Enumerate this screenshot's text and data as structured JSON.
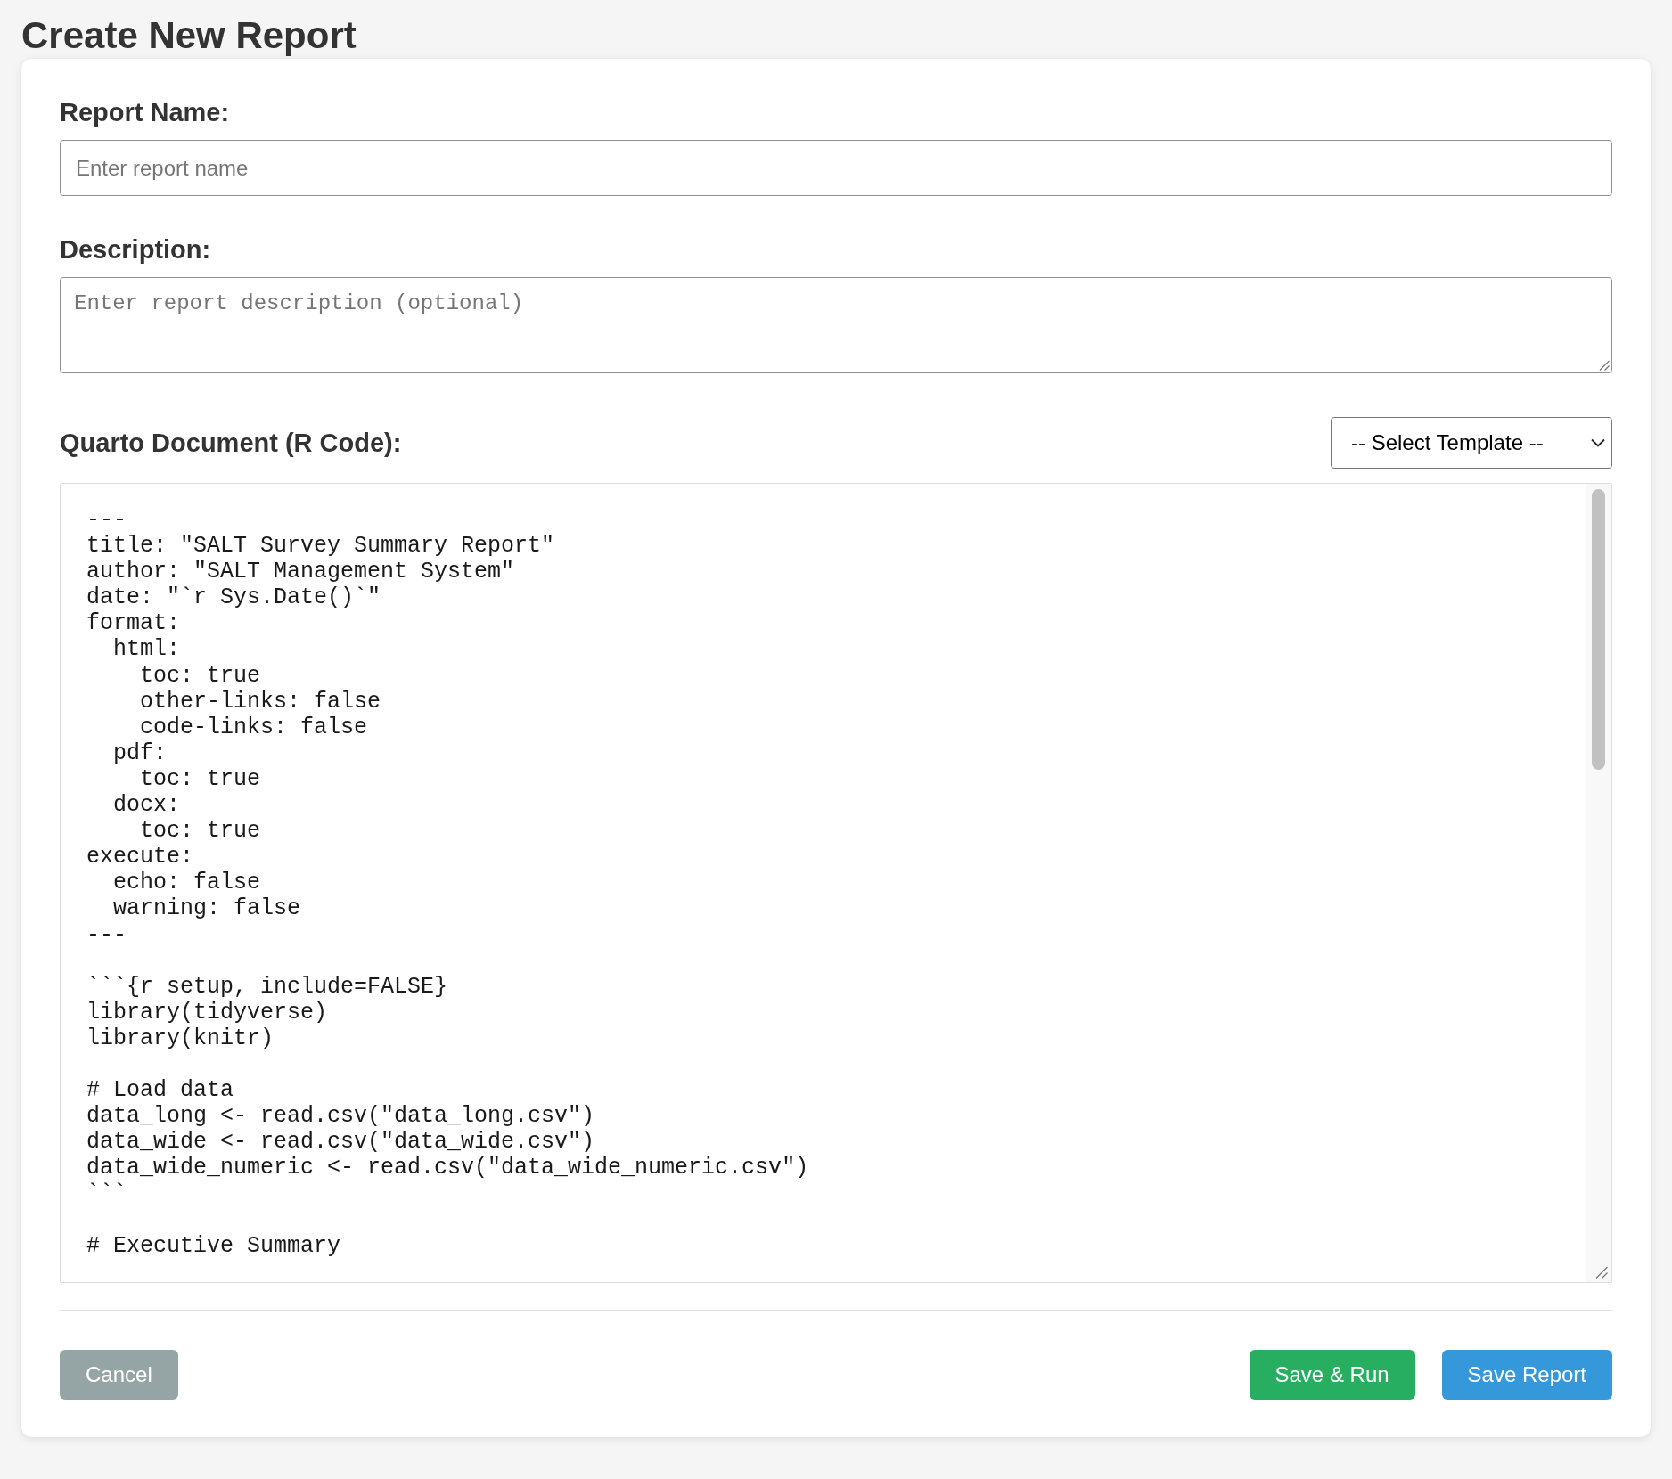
{
  "page": {
    "title": "Create New Report"
  },
  "form": {
    "fields": [
      {
        "kind": "text",
        "label": "Report Name:",
        "placeholder": "Enter report name"
      },
      {
        "kind": "textarea",
        "label": "Description:",
        "placeholder": "Enter report description (optional)"
      }
    ]
  },
  "code_section": {
    "label": "Quarto Document (R Code):",
    "template_select": {
      "value": "-- Select Template --"
    },
    "editor": {
      "value": "---\ntitle: \"SALT Survey Summary Report\"\nauthor: \"SALT Management System\"\ndate: \"`r Sys.Date()`\"\nformat:\n  html:\n    toc: true\n    other-links: false\n    code-links: false\n  pdf:\n    toc: true\n  docx:\n    toc: true\nexecute:\n  echo: false\n  warning: false\n---\n\n```{r setup, include=FALSE}\nlibrary(tidyverse)\nlibrary(knitr)\n\n# Load data\ndata_long <- read.csv(\"data_long.csv\")\ndata_wide <- read.csv(\"data_wide.csv\")\ndata_wide_numeric <- read.csv(\"data_wide_numeric.csv\")\n```\n\n# Executive Summary"
    }
  },
  "footer": {
    "start_buttons": [
      {
        "label": "Cancel",
        "kind": "secondary"
      }
    ],
    "end_buttons": [
      {
        "label": "Save & Run",
        "kind": "success"
      },
      {
        "label": "Save Report",
        "kind": "primary"
      }
    ]
  }
}
